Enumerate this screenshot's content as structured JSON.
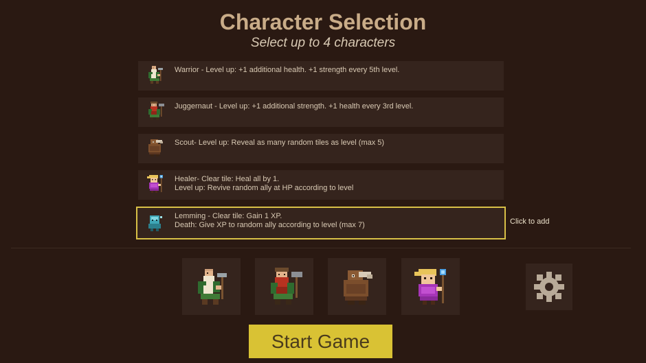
{
  "header": {
    "title": "Character Selection",
    "subtitle": "Select up to 4 characters"
  },
  "characters": [
    {
      "name": "warrior",
      "description": "Warrior - Level up: +1 additional health. +1 strength every 5th level.",
      "icon": "warrior-icon",
      "selected": false
    },
    {
      "name": "juggernaut",
      "description": "Juggernaut - Level up: +1 additional strength. +1 health every 3rd level.",
      "icon": "juggernaut-icon",
      "selected": false
    },
    {
      "name": "scout",
      "description": "Scout- Level up: Reveal as many random tiles as level (max 5)",
      "icon": "scout-icon",
      "selected": false
    },
    {
      "name": "healer",
      "description": "Healer- Clear tile: Heal all by 1.\nLevel up: Revive random ally at HP according to level",
      "icon": "healer-icon",
      "selected": false
    },
    {
      "name": "lemming",
      "description": "Lemming - Clear tile: Gain 1 XP.\nDeath: Give XP to random ally according to level (max 7)",
      "icon": "lemming-icon",
      "selected": true
    }
  ],
  "hover_hint": "Click to add",
  "party_slots": [
    {
      "character": "warrior",
      "icon": "warrior-icon"
    },
    {
      "character": "juggernaut",
      "icon": "juggernaut-icon"
    },
    {
      "character": "scout",
      "icon": "scout-icon"
    },
    {
      "character": "healer",
      "icon": "healer-icon"
    }
  ],
  "settings": {
    "icon": "gear-icon"
  },
  "start_button": {
    "label": "Start Game"
  },
  "colors": {
    "background": "#2a1912",
    "panel": "#35241d",
    "title": "#c9ac88",
    "highlight": "#d9c147",
    "start_button": "#d9c234"
  }
}
